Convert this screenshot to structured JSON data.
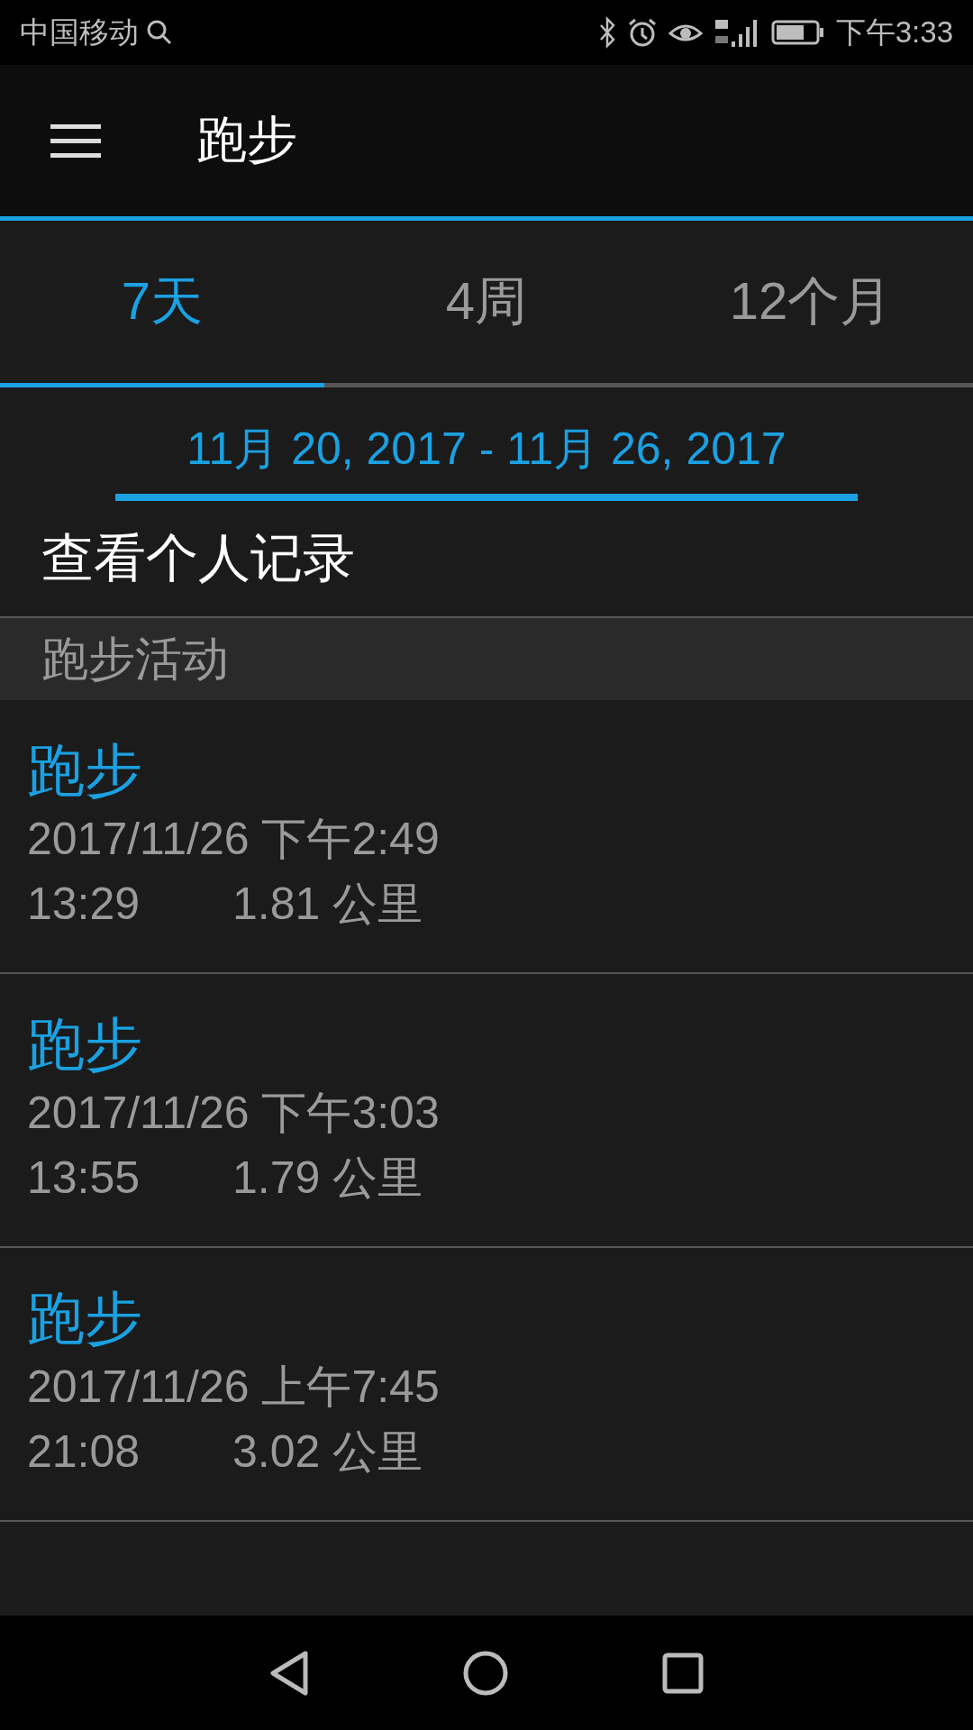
{
  "status_bar": {
    "carrier": "中国移动",
    "time": "下午3:33"
  },
  "toolbar": {
    "title": "跑步"
  },
  "tabs": [
    {
      "label": "7天",
      "selected": true
    },
    {
      "label": "4周",
      "selected": false
    },
    {
      "label": "12个月",
      "selected": false
    }
  ],
  "date_range": "11月 20, 2017 - 11月 26, 2017",
  "records_link": "查看个人记录",
  "section_header": "跑步活动",
  "activities": [
    {
      "title": "跑步",
      "datetime": "2017/11/26 下午2:49",
      "duration": "13:29",
      "distance": "1.81 公里"
    },
    {
      "title": "跑步",
      "datetime": "2017/11/26 下午3:03",
      "duration": "13:55",
      "distance": "1.79 公里"
    },
    {
      "title": "跑步",
      "datetime": "2017/11/26 上午7:45",
      "duration": "21:08",
      "distance": "3.02 公里"
    }
  ]
}
